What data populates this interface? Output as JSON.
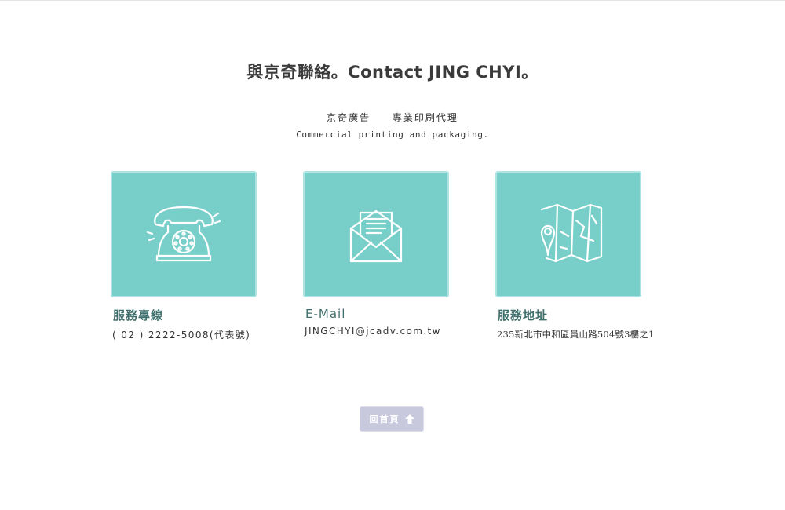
{
  "heading": {
    "title": "與京奇聯絡。Contact JING CHYI。",
    "subtitle_zh": "京奇廣告 專業印刷代理",
    "subtitle_en": "Commercial printing and packaging."
  },
  "cards": [
    {
      "icon": "telephone-icon",
      "label": "服務專線",
      "value": "( 02 ) 2222-5008(代表號)"
    },
    {
      "icon": "envelope-icon",
      "label": "E-Mail",
      "value": "JINGCHYI@jcadv.com.tw"
    },
    {
      "icon": "map-icon",
      "label": "服務地址",
      "value": "235新北市中和區員山路504號3樓之1"
    }
  ],
  "home_button": {
    "label": "回首頁",
    "icon": "up-arrow-icon"
  },
  "colors": {
    "card_bg": "#78cfca",
    "card_border": "#aee4e1",
    "label_text": "#3f6f6c",
    "button_bg": "#c8c9dd"
  }
}
